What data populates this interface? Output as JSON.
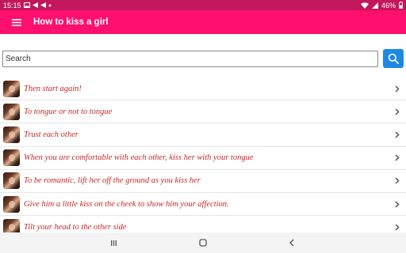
{
  "status_bar": {
    "time": "15:15",
    "battery": "46%",
    "notification_icons": [
      "image-icon",
      "send-icon",
      "send-icon",
      "dot-icon"
    ],
    "system_icons": [
      "wifi-icon",
      "signal-icon",
      "battery-icon"
    ]
  },
  "app_bar": {
    "title": "How to kiss a girl",
    "menu_icon": "hamburger-menu-icon",
    "background_color": "#ff0f6e"
  },
  "search": {
    "placeholder": "Search",
    "value": "",
    "button_icon": "search-icon",
    "button_color": "#1e88e5"
  },
  "list": {
    "text_color": "#c62828",
    "items": [
      {
        "label": "Then start again!"
      },
      {
        "label": "To tongue or not to tongue"
      },
      {
        "label": "Trust each other"
      },
      {
        "label": "When you are comfortable with each other, kiss her with your tongue"
      },
      {
        "label": "To be romantic, lift her off the ground as you kiss her"
      },
      {
        "label": "Give him a little kiss on the cheek to show him your affection."
      },
      {
        "label": "Tilt your head to the other side"
      }
    ]
  },
  "nav_bar": {
    "buttons": [
      "recents-icon",
      "home-icon",
      "back-icon"
    ]
  }
}
